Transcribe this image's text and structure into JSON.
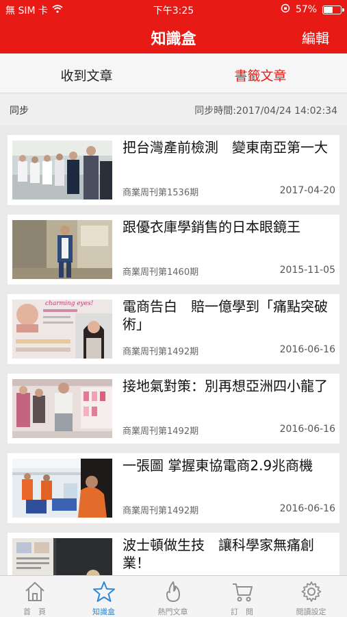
{
  "status_bar": {
    "carrier": "無 SIM 卡",
    "time": "下午3:25",
    "battery_percent": "57%",
    "battery_level": 0.57,
    "icons": [
      "wifi-icon",
      "rotation-lock-icon",
      "battery-icon"
    ]
  },
  "nav": {
    "title": "知識盒",
    "edit_label": "編輯"
  },
  "segments": {
    "left": "收到文章",
    "right": "書籤文章",
    "selected": "right"
  },
  "sync": {
    "label": "同步",
    "time": "同步時間:2017/04/24 14:02:34"
  },
  "articles": [
    {
      "title": "把台灣產前檢測　變東南亞第一大",
      "source": "商業周刊第1536期",
      "date": "2017-04-20"
    },
    {
      "title": "跟優衣庫學銷售的日本眼鏡王",
      "source": "商業周刊第1460期",
      "date": "2015-11-05"
    },
    {
      "title": "電商告白　賠一億學到「痛點突破術」",
      "source": "商業周刊第1492期",
      "date": "2016-06-16"
    },
    {
      "title": "接地氣對策：別再想亞洲四小龍了",
      "source": "商業周刊第1492期",
      "date": "2016-06-16"
    },
    {
      "title": "一張圖 掌握東協電商2.9兆商機",
      "source": "商業周刊第1492期",
      "date": "2016-06-16"
    },
    {
      "title": "波士頓做生技　讓科學家無痛創業！",
      "source": "",
      "date": ""
    }
  ],
  "tabs": [
    {
      "label": "首　頁",
      "icon": "home-icon"
    },
    {
      "label": "知識盒",
      "icon": "star-icon"
    },
    {
      "label": "熱門文章",
      "icon": "flame-icon"
    },
    {
      "label": "訂　閱",
      "icon": "cart-icon"
    },
    {
      "label": "閱讀設定",
      "icon": "gear-icon"
    }
  ],
  "colors": {
    "brand_red": "#e81a16",
    "active_tab": "#2b86d6",
    "inactive_tab": "#8f8f8f"
  },
  "thumb_text": {
    "charming": "charming eyes!"
  }
}
